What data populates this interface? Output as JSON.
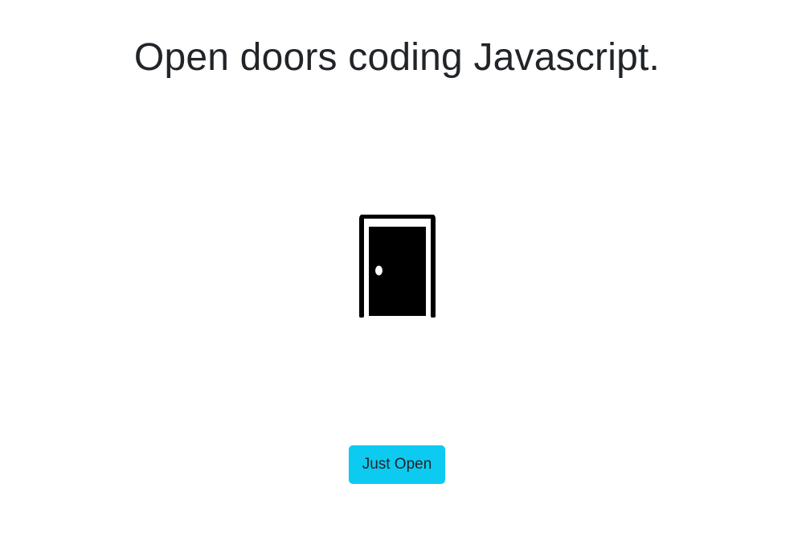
{
  "page": {
    "title": "Open doors coding Javascript."
  },
  "door": {
    "icon": "door-closed-icon",
    "state": "closed"
  },
  "controls": {
    "open_button_label": "Just Open",
    "accent_color": "#0dcaf0"
  }
}
